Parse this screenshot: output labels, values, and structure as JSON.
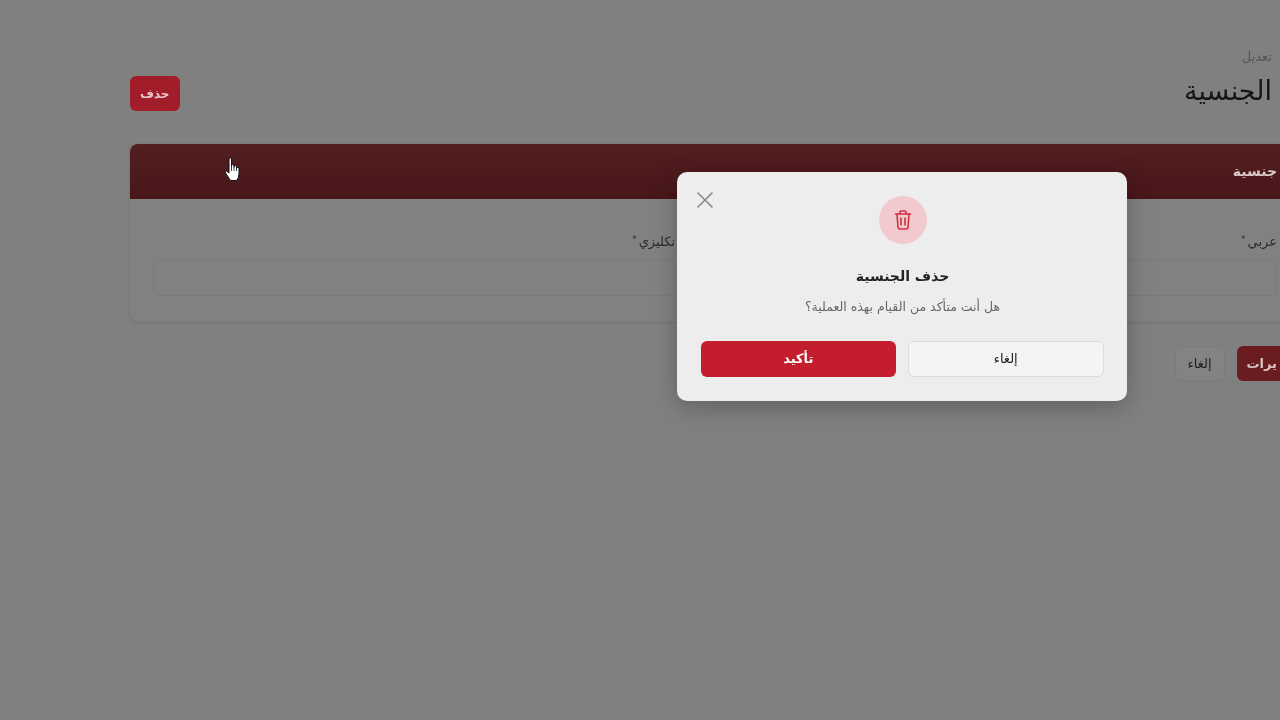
{
  "page_header": {
    "breadcrumb": "تعديل",
    "title": "الجنسية",
    "delete_button": "حذف"
  },
  "form_card": {
    "header": "جنسية",
    "fields": [
      {
        "label": "عربي$^{*}$"
      },
      {
        "label": "نكليزي$^{*}$"
      }
    ]
  },
  "actions": [
    {
      "label": "يرات",
      "kind": "primary"
    },
    {
      "label": "إلغاء",
      "kind": "secondary"
    }
  ],
  "dialog": {
    "title": "حذف الجنسية",
    "message": "هل أنت متأكد من القيام بهذه العملية؟",
    "buttons": [
      {
        "label": "إلغاء",
        "kind": "secondary"
      },
      {
        "label": "تأكيد",
        "kind": "primary"
      }
    ]
  }
}
